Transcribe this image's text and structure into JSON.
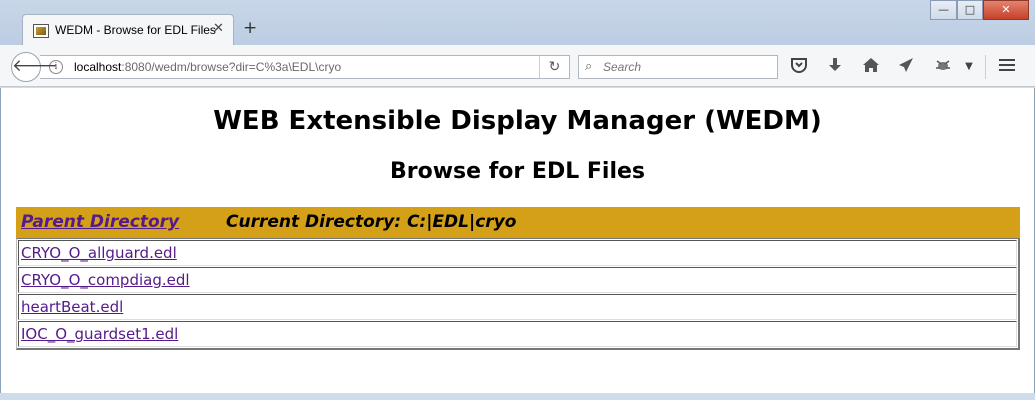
{
  "browser": {
    "tab_title": "WEDM - Browse for EDL Files",
    "tab_close": "✕",
    "new_tab": "+",
    "window_controls": {
      "minimize": "—",
      "maximize": "□",
      "close": "✕"
    },
    "url_host": "localhost",
    "url_rest": ":8080/wedm/browse?dir=C%3a\\EDL\\cryo",
    "search_placeholder": "Search",
    "icons": {
      "back": "back-arrow-icon",
      "info": "info-icon",
      "reload": "reload-icon",
      "search": "search-icon",
      "pocket": "pocket-icon",
      "download": "download-arrow-icon",
      "home": "home-icon",
      "share": "send-icon",
      "extension": "extension-icon",
      "menu": "hamburger-menu-icon"
    }
  },
  "page": {
    "title": "WEB Extensible Display Manager (WEDM)",
    "subtitle": "Browse for EDL Files",
    "parent_directory": "Parent Directory",
    "current_directory": "Current Directory: C:|EDL|cryo",
    "header_color": "#d4a017",
    "link_color": "#551a8b",
    "files": [
      {
        "name": "CRYO_O_allguard.edl"
      },
      {
        "name": "CRYO_O_compdiag.edl"
      },
      {
        "name": "heartBeat.edl"
      },
      {
        "name": "IOC_O_guardset1.edl"
      }
    ]
  }
}
